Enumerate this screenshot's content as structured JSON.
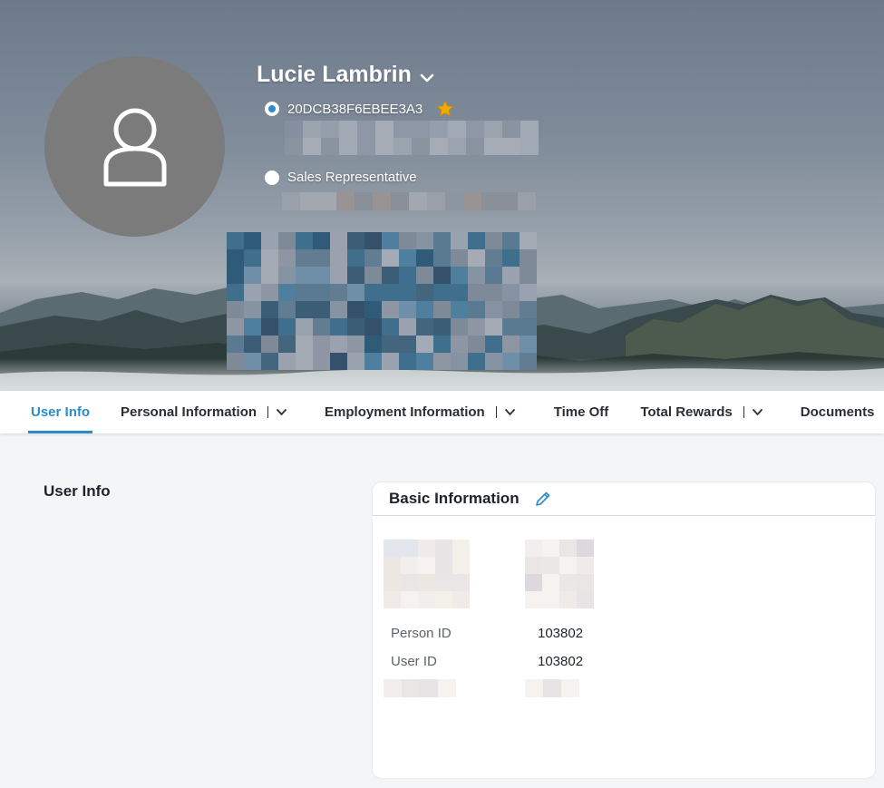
{
  "profile": {
    "name": "Lucie Lambrin",
    "jobs": [
      {
        "label": "20DCB38F6EBEE3A3",
        "selected": true,
        "favorite": true
      },
      {
        "label": "Sales Representative",
        "selected": false,
        "favorite": false
      }
    ]
  },
  "icons": {
    "avatar": "user-silhouette-icon",
    "name_menu": "chevron-down-icon",
    "favorite": "star-icon",
    "edit": "pencil-icon",
    "tab_menu": "chevron-down-icon"
  },
  "tabs": [
    {
      "label": "User Info",
      "active": true,
      "menu": false
    },
    {
      "label": "Personal Information",
      "active": false,
      "menu": true
    },
    {
      "label": "Employment Information",
      "active": false,
      "menu": true
    },
    {
      "label": "Time Off",
      "active": false,
      "menu": false
    },
    {
      "label": "Total Rewards",
      "active": false,
      "menu": true
    },
    {
      "label": "Documents",
      "active": false,
      "menu": false
    }
  ],
  "content": {
    "section_title": "User Info",
    "card": {
      "title": "Basic Information",
      "fields": [
        {
          "label": "Person ID",
          "value": "103802"
        },
        {
          "label": "User ID",
          "value": "103802"
        }
      ]
    }
  },
  "colors": {
    "accent": "#2b8bc9",
    "avatar_bg": "#7b7b7b",
    "page_bg": "#f4f5f7",
    "star": "#f0ab00"
  }
}
